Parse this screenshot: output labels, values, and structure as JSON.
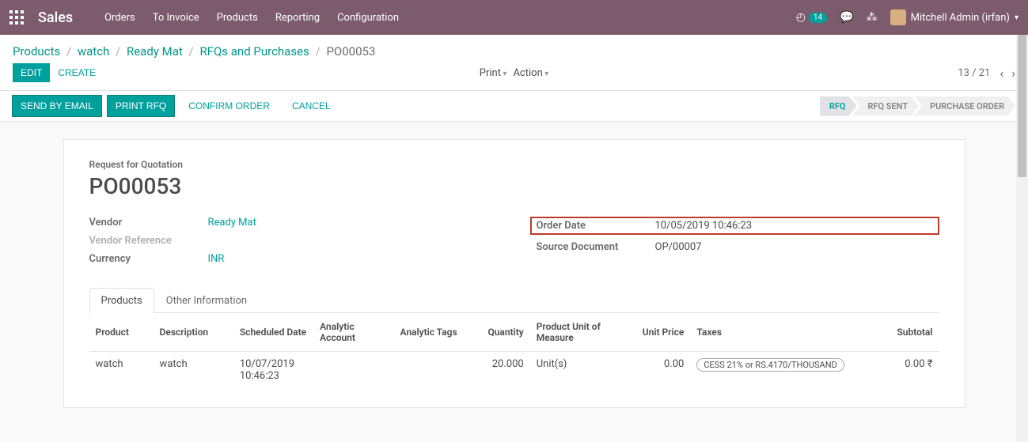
{
  "nav": {
    "brand": "Sales",
    "links": [
      "Orders",
      "To Invoice",
      "Products",
      "Reporting",
      "Configuration"
    ],
    "notif_count": "14",
    "user": "Mitchell Admin (irfan)"
  },
  "breadcrumb": {
    "items": [
      "Products",
      "watch",
      "Ready Mat",
      "RFQs and Purchases"
    ],
    "current": "PO00053"
  },
  "toolbar": {
    "edit": "Edit",
    "create": "Create",
    "print": "Print",
    "action": "Action",
    "pager": "13 / 21"
  },
  "actions": {
    "send_email": "Send by Email",
    "print_rfq": "Print RFQ",
    "confirm": "Confirm Order",
    "cancel": "Cancel"
  },
  "stages": [
    "RFQ",
    "RFQ Sent",
    "Purchase Order"
  ],
  "form": {
    "subtitle": "Request for Quotation",
    "title": "PO00053",
    "left": {
      "vendor_label": "Vendor",
      "vendor": "Ready Mat",
      "vendor_ref_label": "Vendor Reference",
      "currency_label": "Currency",
      "currency": "INR"
    },
    "right": {
      "order_date_label": "Order Date",
      "order_date": "10/05/2019 10:46:23",
      "source_label": "Source Document",
      "source": "OP/00007"
    }
  },
  "tabs": {
    "products": "Products",
    "other": "Other Information"
  },
  "table": {
    "headers": {
      "product": "Product",
      "description": "Description",
      "sched": "Scheduled Date",
      "analytic_acc": "Analytic Account",
      "analytic_tags": "Analytic Tags",
      "qty": "Quantity",
      "uom": "Product Unit of Measure",
      "unit_price": "Unit Price",
      "taxes": "Taxes",
      "subtotal": "Subtotal"
    },
    "rows": [
      {
        "product": "watch",
        "description": "watch",
        "sched": "10/07/2019 10:46:23",
        "qty": "20.000",
        "uom": "Unit(s)",
        "unit_price": "0.00",
        "tax": "CESS 21% or RS.4170/THOUSAND",
        "subtotal": "0.00 ₹"
      }
    ]
  }
}
